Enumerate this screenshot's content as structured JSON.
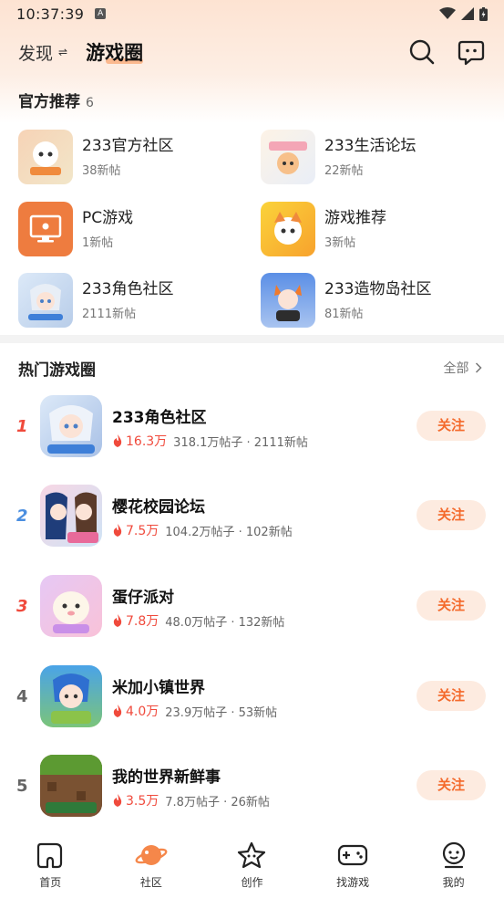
{
  "status": {
    "time": "10:37:39",
    "indicator": "A"
  },
  "header": {
    "discover_label": "发现",
    "swap_glyph": "⇌",
    "active_tab": "游戏圈"
  },
  "official": {
    "title": "官方推荐",
    "count": "6",
    "items": [
      {
        "name": "233官方社区",
        "sub": "38新帖"
      },
      {
        "name": "233生活论坛",
        "sub": "22新帖"
      },
      {
        "name": "PC游戏",
        "sub": "1新帖"
      },
      {
        "name": "游戏推荐",
        "sub": "3新帖"
      },
      {
        "name": "233角色社区",
        "sub": "2111新帖"
      },
      {
        "name": "233造物岛社区",
        "sub": "81新帖"
      }
    ]
  },
  "hot": {
    "title": "热门游戏圈",
    "all_label": "全部",
    "follow_label": "关注",
    "rows": [
      {
        "rank": "1",
        "name": "233角色社区",
        "heat": "16.3万",
        "stats": "318.1万帖子 · 2111新帖"
      },
      {
        "rank": "2",
        "name": "樱花校园论坛",
        "heat": "7.5万",
        "stats": "104.2万帖子 · 102新帖"
      },
      {
        "rank": "3",
        "name": "蛋仔派对",
        "heat": "7.8万",
        "stats": "48.0万帖子 · 132新帖"
      },
      {
        "rank": "4",
        "name": "米加小镇世界",
        "heat": "4.0万",
        "stats": "23.9万帖子 · 53新帖"
      },
      {
        "rank": "5",
        "name": "我的世界新鲜事",
        "heat": "3.5万",
        "stats": "7.8万帖子 · 26新帖"
      }
    ]
  },
  "nav": [
    {
      "label": "首页"
    },
    {
      "label": "社区"
    },
    {
      "label": "创作"
    },
    {
      "label": "找游戏"
    },
    {
      "label": "我的"
    }
  ],
  "colors": {
    "accent": "#f46a2c",
    "heat": "#f04a3c",
    "rank_top": "#f04a3c",
    "rank_blue": "#4a8ee0"
  }
}
